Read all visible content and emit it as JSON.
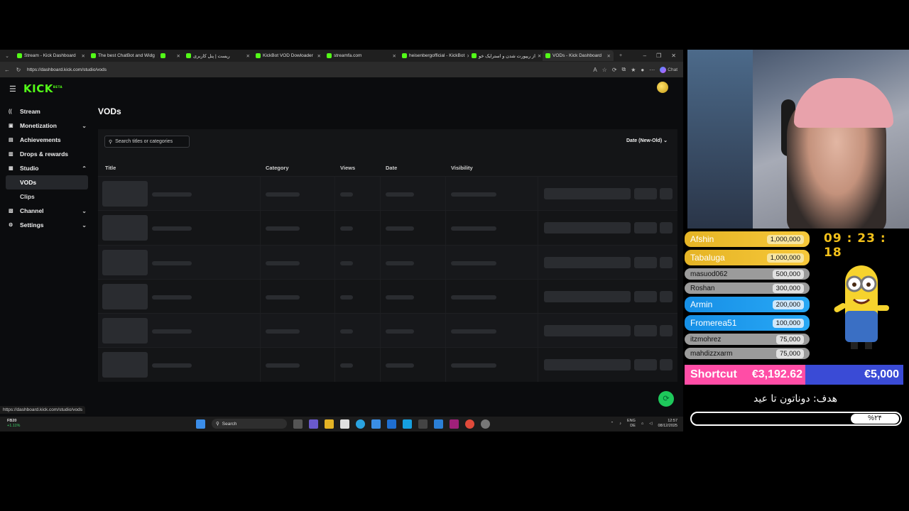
{
  "browser": {
    "tabs": [
      {
        "label": "Stream - Kick Dashboard",
        "active": false
      },
      {
        "label": "The best ChatBot and Widg",
        "active": false
      },
      {
        "label": "",
        "active": false
      },
      {
        "label": "ریست | پنل کاربری",
        "active": false
      },
      {
        "label": "KickBot VOD Dowloader",
        "active": false
      },
      {
        "label": "streamfa.com",
        "active": false
      },
      {
        "label": "heisenbergofficial - KickBot",
        "active": false
      },
      {
        "label": "از ریپورت شدن و استرایک خو",
        "active": false
      },
      {
        "label": "VODs - Kick Dashboard",
        "active": true
      }
    ],
    "url": "https://dashboard.kick.com/studio/vods",
    "chat_label": "Chat",
    "status_url": "https://dashboard.kick.com/studio/vods"
  },
  "app": {
    "logo": "KICK",
    "logo_badge": "BETA",
    "page_title": "VODs",
    "search_placeholder": "Search titles or categories",
    "sort_label": "Date (New-Old)",
    "sidebar": [
      {
        "label": "Stream",
        "icon": "stream-icon",
        "chevron": ""
      },
      {
        "label": "Monetization",
        "icon": "monetization-icon",
        "chevron": "down"
      },
      {
        "label": "Achievements",
        "icon": "achievements-icon",
        "chevron": ""
      },
      {
        "label": "Drops & rewards",
        "icon": "drops-icon",
        "chevron": ""
      },
      {
        "label": "Studio",
        "icon": "studio-icon",
        "chevron": "up"
      },
      {
        "label": "Channel",
        "icon": "channel-icon",
        "chevron": "down"
      },
      {
        "label": "Settings",
        "icon": "settings-icon",
        "chevron": "down"
      }
    ],
    "studio_sub": [
      {
        "label": "VODs",
        "active": true
      },
      {
        "label": "Clips",
        "active": false
      }
    ],
    "columns": [
      "Title",
      "Category",
      "Views",
      "Date",
      "Visibility"
    ],
    "skeleton_rows": 6
  },
  "taskbar": {
    "stock_name": "FB20",
    "stock_change": "+1.11%",
    "search": "Search",
    "lang_top": "ENG",
    "lang_bottom": "DE",
    "time": "12:57",
    "date": "08/12/2025"
  },
  "overlay": {
    "leaderboard": [
      {
        "name": "Afshin",
        "amount": "1,000,000",
        "style": "gold"
      },
      {
        "name": "Tabaluga",
        "amount": "1,000,000",
        "style": "gold"
      },
      {
        "name": "masuod062",
        "amount": "500,000",
        "style": "gray"
      },
      {
        "name": "Roshan",
        "amount": "300,000",
        "style": "gray"
      },
      {
        "name": "Armin",
        "amount": "200,000",
        "style": "blue"
      },
      {
        "name": "Fromerea51",
        "amount": "100,000",
        "style": "blue"
      },
      {
        "name": "itzmohrez",
        "amount": "75,000",
        "style": "gray"
      },
      {
        "name": "mahdizzxarm",
        "amount": "75,000",
        "style": "gray"
      }
    ],
    "timer": "09 : 23 : 18",
    "goal_label": "Shortcut",
    "goal_current": "€3,192.62",
    "goal_target": "€5,000",
    "goal_title": "هدف: دوناتون تا عید",
    "goal_percent": "%۲۴",
    "colors": {
      "accent": "#53fc18",
      "gold": "#f2c01a",
      "pink": "#ff4da6",
      "blue": "#3a4bd6"
    }
  }
}
